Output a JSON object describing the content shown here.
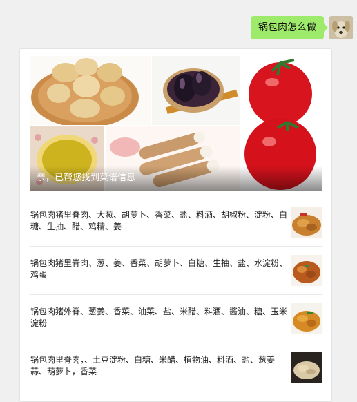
{
  "message": {
    "text": "锅包肉怎么做"
  },
  "card": {
    "caption": "亲，已帮您找到菜谱信息",
    "recipes": [
      {
        "text": "锅包肉猪里脊肉、大葱、胡萝卜、香菜、盐、料酒、胡椒粉、淀粉、白糖、生抽、醋、鸡精、姜"
      },
      {
        "text": "锅包肉猪里脊肉、葱、姜、香菜、胡萝卜、白糖、生抽、盐、水淀粉、鸡蛋"
      },
      {
        "text": "锅包肉猪外脊、葱姜、香菜、油菜、盐、米醋、料酒、酱油、糖、玉米淀粉"
      },
      {
        "text": "锅包肉里脊肉，、土豆淀粉、白糖、米醋、植物油、料酒、盐、葱姜蒜、葫萝卜，香菜"
      }
    ]
  },
  "colors": {
    "bubble": "#9eea6a",
    "background": "#f0f0f0"
  },
  "icons": {
    "avatar": "dog-avatar-icon"
  }
}
